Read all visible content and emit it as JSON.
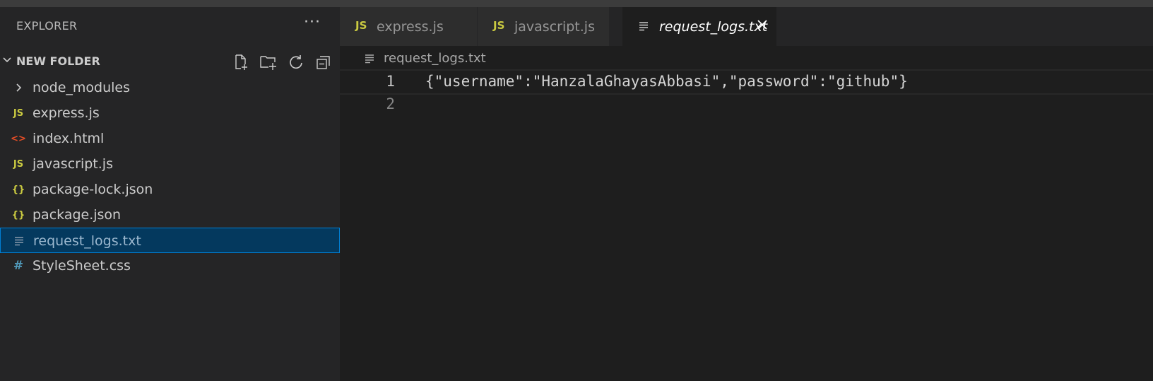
{
  "sidebar": {
    "header": "EXPLORER",
    "more_label": "···",
    "folder": {
      "title": "NEW FOLDER",
      "actions": [
        "new-file",
        "new-folder",
        "refresh",
        "collapse-all"
      ]
    },
    "items": [
      {
        "label": "node_modules",
        "icon": "chevron-right-icon",
        "glyph": "",
        "color": "#cccccc"
      },
      {
        "label": "express.js",
        "icon": "js-icon",
        "glyph": "JS",
        "color": "#cbcb41"
      },
      {
        "label": "index.html",
        "icon": "html-icon",
        "glyph": "<>",
        "color": "#e44d26"
      },
      {
        "label": "javascript.js",
        "icon": "js-icon",
        "glyph": "JS",
        "color": "#cbcb41"
      },
      {
        "label": "package-lock.json",
        "icon": "json-icon",
        "glyph": "{}",
        "color": "#cbcb41"
      },
      {
        "label": "package.json",
        "icon": "json-icon",
        "glyph": "{}",
        "color": "#cbcb41"
      },
      {
        "label": "request_logs.txt",
        "icon": "text-file-icon",
        "glyph": "≡",
        "color": "#8a9aab",
        "selected": true
      },
      {
        "label": "StyleSheet.css",
        "icon": "css-icon",
        "glyph": "#",
        "color": "#519aba"
      }
    ]
  },
  "tabs": [
    {
      "label": "express.js",
      "glyph": "JS",
      "active": false
    },
    {
      "label": "javascript.js",
      "glyph": "JS",
      "active": false
    },
    {
      "label": "request_logs.txt",
      "glyph": "≡",
      "active": true
    }
  ],
  "breadcrumb": {
    "label": "request_logs.txt"
  },
  "editor": {
    "lines": [
      {
        "number": "1",
        "text": "{\"username\":\"HanzalaGhayasAbbasi\",\"password\":\"github\"}"
      },
      {
        "number": "2",
        "text": ""
      }
    ]
  },
  "colors": {
    "sidebar_bg": "#252526",
    "editor_bg": "#1e1e1e",
    "selection_bg": "#04395e",
    "selection_border": "#007fd4"
  }
}
